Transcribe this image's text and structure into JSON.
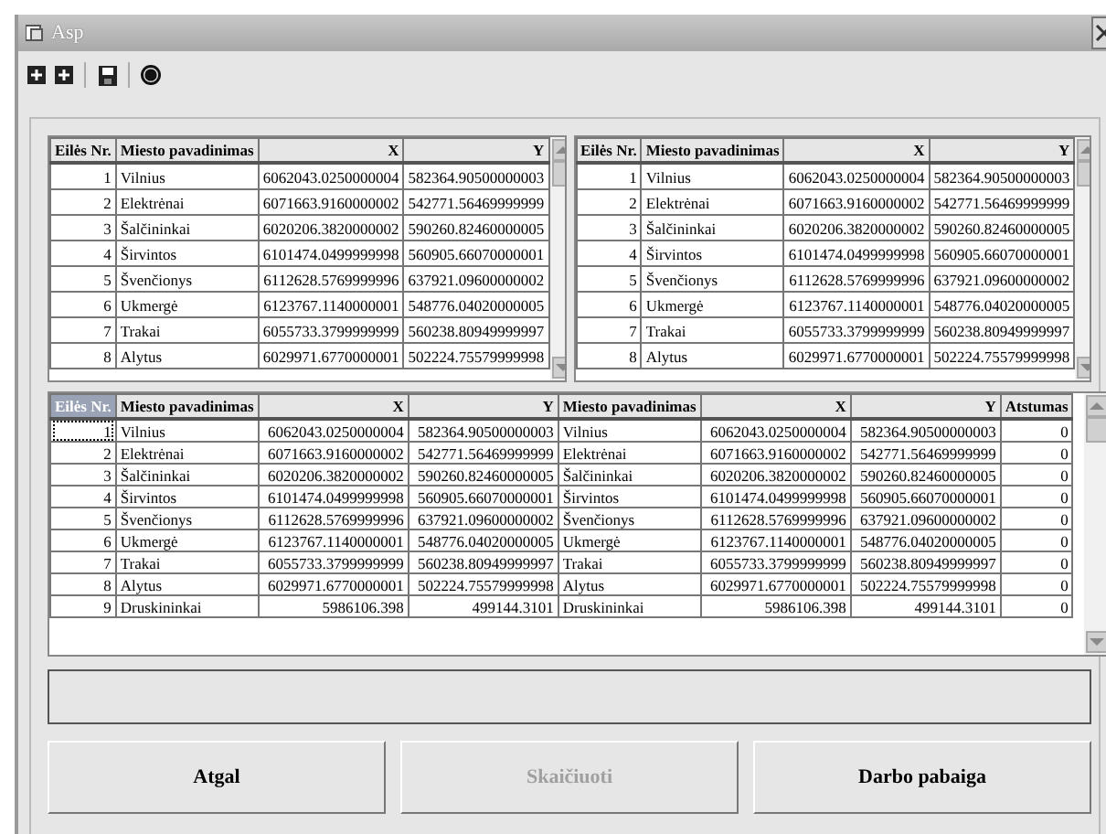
{
  "window": {
    "title": "Asp"
  },
  "toolbar": {
    "buttons": [
      {
        "kind": "plus"
      },
      {
        "kind": "plus"
      },
      {
        "kind": "save"
      },
      {
        "kind": "stop"
      }
    ]
  },
  "top_left_grid": {
    "columns": [
      "Eilės Nr.",
      "Miesto pavadinimas",
      "X",
      "Y"
    ],
    "rows": [
      [
        "1",
        "Vilnius",
        "6062043.0250000004",
        "582364.90500000003"
      ],
      [
        "2",
        "Elektrėnai",
        "6071663.9160000002",
        "542771.56469999999"
      ],
      [
        "3",
        "Šalčininkai",
        "6020206.3820000002",
        "590260.82460000005"
      ],
      [
        "4",
        "Širvintos",
        "6101474.0499999998",
        "560905.66070000001"
      ],
      [
        "5",
        "Švenčionys",
        "6112628.5769999996",
        "637921.09600000002"
      ],
      [
        "6",
        "Ukmergė",
        "6123767.1140000001",
        "548776.04020000005"
      ],
      [
        "7",
        "Trakai",
        "6055733.3799999999",
        "560238.80949999997"
      ],
      [
        "8",
        "Alytus",
        "6029971.6770000001",
        "502224.75579999998"
      ]
    ]
  },
  "top_right_grid": {
    "columns": [
      "Eilės Nr.",
      "Miesto pavadinimas",
      "X",
      "Y"
    ],
    "rows": [
      [
        "1",
        "Vilnius",
        "6062043.0250000004",
        "582364.90500000003"
      ],
      [
        "2",
        "Elektrėnai",
        "6071663.9160000002",
        "542771.56469999999"
      ],
      [
        "3",
        "Šalčininkai",
        "6020206.3820000002",
        "590260.82460000005"
      ],
      [
        "4",
        "Širvintos",
        "6101474.0499999998",
        "560905.66070000001"
      ],
      [
        "5",
        "Švenčionys",
        "6112628.5769999996",
        "637921.09600000002"
      ],
      [
        "6",
        "Ukmergė",
        "6123767.1140000001",
        "548776.04020000005"
      ],
      [
        "7",
        "Trakai",
        "6055733.3799999999",
        "560238.80949999997"
      ],
      [
        "8",
        "Alytus",
        "6029971.6770000001",
        "502224.75579999998"
      ]
    ]
  },
  "result_grid": {
    "columns": [
      {
        "label": "Eilės Nr.",
        "selected": true
      },
      {
        "label": "Miesto pavadinimas",
        "selected": false
      },
      {
        "label": "X",
        "selected": false
      },
      {
        "label": "Y",
        "selected": false
      },
      {
        "label": "Miesto pavadinimas",
        "selected": false
      },
      {
        "label": "X",
        "selected": false
      },
      {
        "label": "Y",
        "selected": false
      },
      {
        "label": "Atstumas",
        "selected": false
      }
    ],
    "rows": [
      {
        "focused": true,
        "cells": [
          "1",
          "Vilnius",
          "6062043.0250000004",
          "582364.90500000003",
          "Vilnius",
          "6062043.0250000004",
          "582364.90500000003",
          "0"
        ]
      },
      {
        "focused": false,
        "cells": [
          "2",
          "Elektrėnai",
          "6071663.9160000002",
          "542771.56469999999",
          "Elektrėnai",
          "6071663.9160000002",
          "542771.56469999999",
          "0"
        ]
      },
      {
        "focused": false,
        "cells": [
          "3",
          "Šalčininkai",
          "6020206.3820000002",
          "590260.82460000005",
          "Šalčininkai",
          "6020206.3820000002",
          "590260.82460000005",
          "0"
        ]
      },
      {
        "focused": false,
        "cells": [
          "4",
          "Širvintos",
          "6101474.0499999998",
          "560905.66070000001",
          "Širvintos",
          "6101474.0499999998",
          "560905.66070000001",
          "0"
        ]
      },
      {
        "focused": false,
        "cells": [
          "5",
          "Švenčionys",
          "6112628.5769999996",
          "637921.09600000002",
          "Švenčionys",
          "6112628.5769999996",
          "637921.09600000002",
          "0"
        ]
      },
      {
        "focused": false,
        "cells": [
          "6",
          "Ukmergė",
          "6123767.1140000001",
          "548776.04020000005",
          "Ukmergė",
          "6123767.1140000001",
          "548776.04020000005",
          "0"
        ]
      },
      {
        "focused": false,
        "cells": [
          "7",
          "Trakai",
          "6055733.3799999999",
          "560238.80949999997",
          "Trakai",
          "6055733.3799999999",
          "560238.80949999997",
          "0"
        ]
      },
      {
        "focused": false,
        "cells": [
          "8",
          "Alytus",
          "6029971.6770000001",
          "502224.75579999998",
          "Alytus",
          "6029971.6770000001",
          "502224.75579999998",
          "0"
        ]
      },
      {
        "focused": false,
        "cells": [
          "9",
          "Druskininkai",
          "5986106.398",
          "499144.3101",
          "Druskininkai",
          "5986106.398",
          "499144.3101",
          "0"
        ]
      }
    ]
  },
  "buttons": [
    {
      "label": "Atgal",
      "disabled": false
    },
    {
      "label": "Skaičiuoti",
      "disabled": true
    },
    {
      "label": "Darbo pabaiga",
      "disabled": false
    }
  ]
}
